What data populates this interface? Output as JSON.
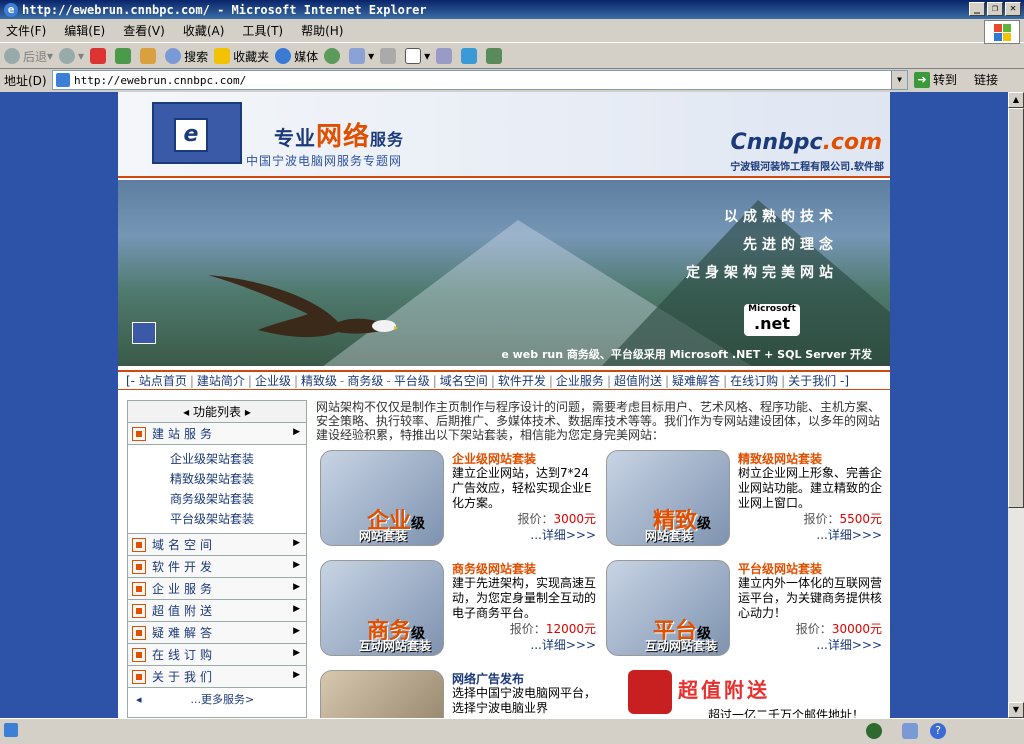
{
  "window": {
    "title": "http://ewebrun.cnnbpc.com/ - Microsoft Internet Explorer"
  },
  "menu": [
    "文件(F)",
    "编辑(E)",
    "查看(V)",
    "收藏(A)",
    "工具(T)",
    "帮助(H)"
  ],
  "toolbar": {
    "back": "后退",
    "search": "搜索",
    "favorites": "收藏夹",
    "media": "媒体"
  },
  "address": {
    "label": "地址(D)",
    "url": "http://ewebrun.cnnbpc.com/",
    "go": "转到",
    "links": "链接"
  },
  "header": {
    "title_main": "专业",
    "title_red": "网络",
    "title_tail": "服务",
    "subtitle": "中国宁波电脑网服务专题网",
    "brand_a": "Cnnbpc",
    "brand_b": ".com",
    "brand_sub": "宁波银河装饰工程有限公司.软件部"
  },
  "banner": {
    "slogan1": "以成熟的技术",
    "slogan2": "先进的理念",
    "slogan3": "定身架构完美网站",
    "net_top": "Microsoft",
    "net_logo": ".net",
    "footer": "e web run 商务级、平台级采用 Microsoft .NET + SQL Server 开发"
  },
  "nav": [
    "站点首页",
    "建站简介",
    "企业级",
    "精致级",
    "商务级",
    "平台级",
    "域名空间",
    "软件开发",
    "企业服务",
    "超值附送",
    "疑难解答",
    "在线订购",
    "关于我们"
  ],
  "sidebar": {
    "head": "功能列表",
    "build": "建站服务",
    "sub": [
      "企业级架站套装",
      "精致级架站套装",
      "商务级架站套装",
      "平台级架站套装"
    ],
    "items": [
      "域名空间",
      "软件开发",
      "企业服务",
      "超值附送",
      "疑难解答",
      "在线订购",
      "关于我们"
    ],
    "more": "...更多服务>"
  },
  "intro": "网站架构不仅仅是制作主页制作与程序设计的问题，需要考虑目标用户、艺术风格、程序功能、主机方案、安全策略、执行较率、后期推广、多媒体技术、数据库技术等等。我们作为专网站建设团体，以多年的网站建设经验积累，特推出以下架站套装，相信能为您定身完美网站：",
  "products": [
    {
      "title": "企业级网站套装",
      "desc": "建立企业网站，达到7*24广告效应，轻松实现企业E化方案。",
      "price_label": "报价：",
      "price": "3000元",
      "more": "...详细>>>",
      "img_big": "企业",
      "img_lvl": "级",
      "img_cap": "网站套装"
    },
    {
      "title": "精致级网站套装",
      "desc": "树立企业网上形象、完善企业网站功能。建立精致的企业网上窗口。",
      "price_label": "报价：",
      "price": "5500元",
      "more": "...详细>>>",
      "img_big": "精致",
      "img_lvl": "级",
      "img_cap": "网站套装"
    },
    {
      "title": "商务级网站套装",
      "desc": "建于先进架构，实现高速互动，为您定身量制全互动的电子商务平台。",
      "price_label": "报价：",
      "price": "12000元",
      "more": "...详细>>>",
      "img_big": "商务",
      "img_lvl": "级",
      "img_cap": "互动网站套装"
    },
    {
      "title": "平台级网站套装",
      "desc": "建立内外一体化的互联网营运平台，为关键商务提供核心动力！",
      "price_label": "报价：",
      "price": "30000元",
      "more": "...详细>>>",
      "img_big": "平台",
      "img_lvl": "级",
      "img_cap": "互动网站套装"
    }
  ],
  "ad": {
    "title": "网络广告发布",
    "desc": "选择中国宁波电脑网平台，选择宁波电脑业界",
    "promo": "超值附送",
    "promo_sub": "超过一亿二千万个邮件地址！"
  }
}
